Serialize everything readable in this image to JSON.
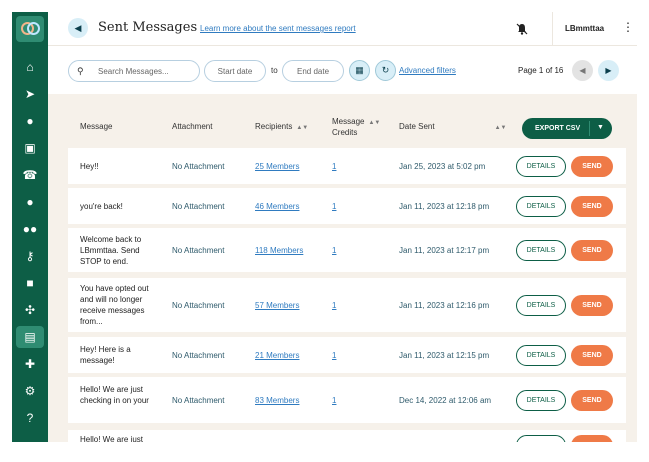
{
  "header": {
    "title": "Sent Messages",
    "learn_more": "Learn more about the sent messages report",
    "user": "LBmmttaa"
  },
  "filters": {
    "search_placeholder": "Search Messages...",
    "start_placeholder": "Start date",
    "to_label": "to",
    "end_placeholder": "End date",
    "advanced_label": "Advanced filters",
    "page_info": "Page 1 of 16"
  },
  "table": {
    "headers": {
      "message": "Message",
      "attachment": "Attachment",
      "recipients": "Recipients",
      "credits_l1": "Message",
      "credits_l2": "Credits",
      "date_sent": "Date Sent"
    },
    "export_label": "EXPORT CSV",
    "details_label": "DETAILS",
    "send_label": "SEND",
    "rows": [
      {
        "message": "Hey!!",
        "attachment": "No Attachment",
        "recipients": "25 Members",
        "credits": "1",
        "date": "Jan 25, 2023 at 5:02 pm"
      },
      {
        "message": "you're back!",
        "attachment": "No Attachment",
        "recipients": "46 Members",
        "credits": "1",
        "date": "Jan 11, 2023 at 12:18 pm"
      },
      {
        "message": "Welcome back to LBmmttaa. Send STOP to end.",
        "attachment": "No Attachment",
        "recipients": "118 Members",
        "credits": "1",
        "date": "Jan 11, 2023 at 12:17 pm"
      },
      {
        "message": "You have opted out and will no longer receive messages from...",
        "attachment": "No Attachment",
        "recipients": "57 Members",
        "credits": "1",
        "date": "Jan 11, 2023 at 12:16 pm"
      },
      {
        "message": "Hey! Here is a message!",
        "attachment": "No Attachment",
        "recipients": "21 Members",
        "credits": "1",
        "date": "Jan 11, 2023 at 12:15 pm"
      },
      {
        "message": "Hello! We are just checking in on your",
        "attachment": "No Attachment",
        "recipients": "83 Members",
        "credits": "1",
        "date": "Dec 14, 2022 at 12:06 am"
      },
      {
        "message": "Hello! We are just",
        "attachment": "",
        "recipients": "",
        "credits": "",
        "date": ""
      }
    ]
  },
  "colors": {
    "brand": "#0d5e46",
    "accent": "#ef7a47",
    "link": "#2f7bc0"
  }
}
